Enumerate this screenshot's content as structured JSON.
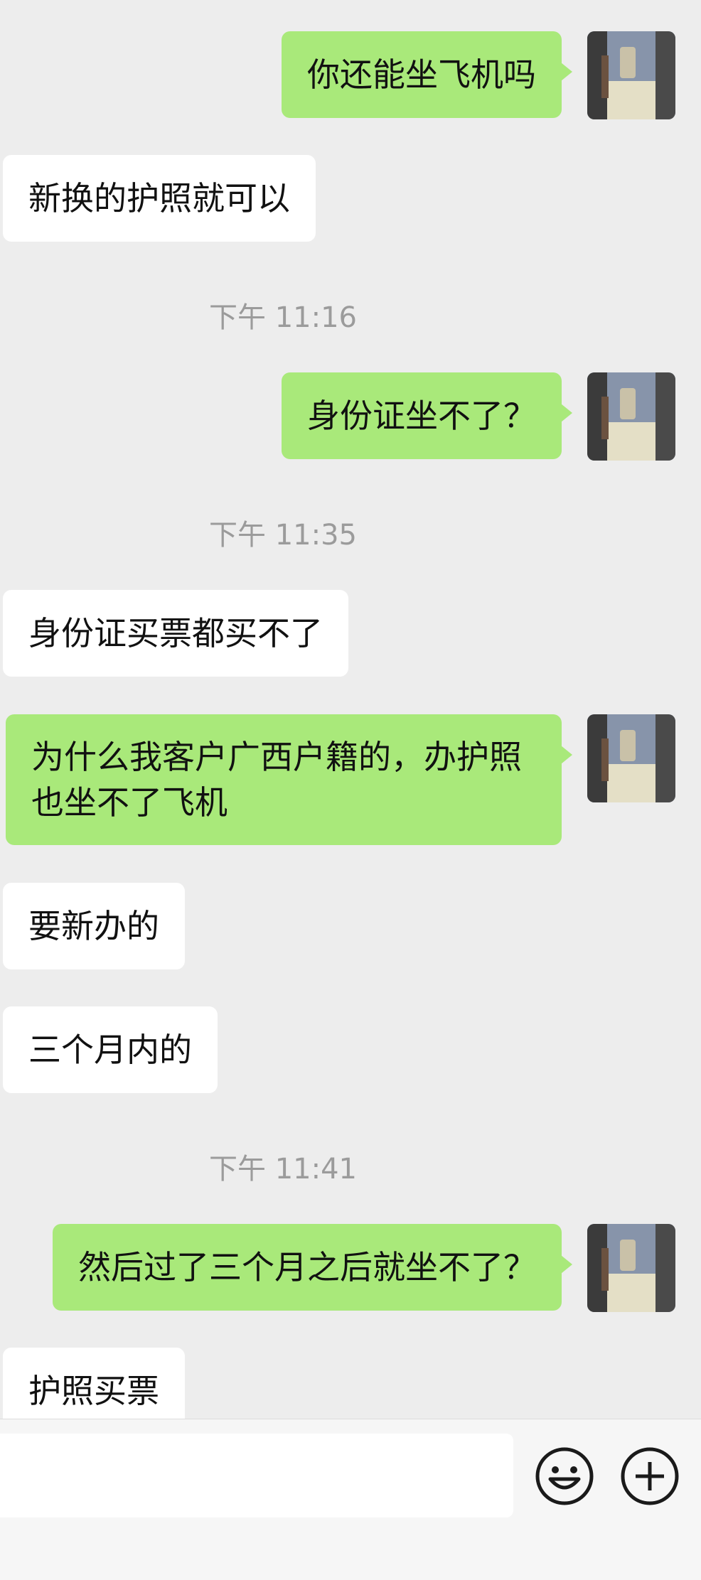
{
  "messages": [
    {
      "type": "out",
      "text": "你还能坐飞机吗"
    },
    {
      "type": "in",
      "text": "新换的护照就可以"
    },
    {
      "type": "time",
      "text": "下午 11:16"
    },
    {
      "type": "out",
      "text": "身份证坐不了？"
    },
    {
      "type": "time",
      "text": "下午 11:35"
    },
    {
      "type": "in",
      "text": "身份证买票都买不了"
    },
    {
      "type": "out",
      "text": "为什么我客户广西户籍的，办护照也坐不了飞机"
    },
    {
      "type": "in",
      "text": "要新办的"
    },
    {
      "type": "in",
      "text": "三个月内的"
    },
    {
      "type": "time",
      "text": "下午 11:41"
    },
    {
      "type": "out",
      "text": "然后过了三个月之后就坐不了？"
    },
    {
      "type": "in",
      "text": "护照买票"
    }
  ],
  "input_bar": {
    "text_value": "",
    "emoji_icon": "smiley-face-icon",
    "plus_icon": "plus-circle-icon"
  },
  "colors": {
    "background": "#ededed",
    "outgoing_bubble": "#a9e97a",
    "incoming_bubble": "#ffffff",
    "timestamp_text": "#9b9b9b"
  }
}
